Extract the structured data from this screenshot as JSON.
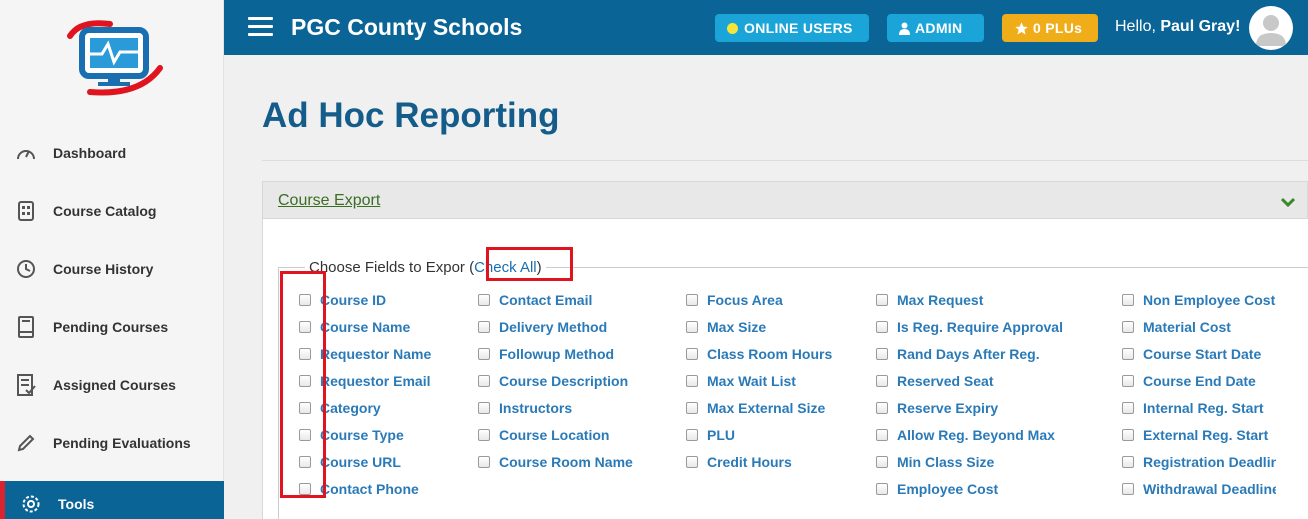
{
  "header": {
    "brand": "PGC County Schools",
    "online_users": "ONLINE USERS",
    "admin": "ADMIN",
    "plus": "0 PLUs",
    "hello": "Hello,",
    "user": "Paul Gray!"
  },
  "sidebar": {
    "items": [
      {
        "label": "Dashboard",
        "icon": "gauge-icon"
      },
      {
        "label": "Course Catalog",
        "icon": "catalog-icon"
      },
      {
        "label": "Course History",
        "icon": "history-icon"
      },
      {
        "label": "Pending Courses",
        "icon": "book-icon"
      },
      {
        "label": "Assigned Courses",
        "icon": "checklist-icon"
      },
      {
        "label": "Pending Evaluations",
        "icon": "pencil-icon"
      },
      {
        "label": "Tools",
        "icon": "gear-icon",
        "active": true
      }
    ]
  },
  "main": {
    "title": "Ad Hoc Reporting",
    "panel_title": "Course Export",
    "legend_text": "Choose Fields to Expor",
    "check_all": "Check All"
  },
  "fields": {
    "col1": [
      "Course ID",
      "Course Name",
      "Requestor Name",
      "Requestor Email",
      "Category",
      "Course Type",
      "Course URL",
      "Contact Phone"
    ],
    "col2": [
      "Contact Email",
      "Delivery Method",
      "Followup Method",
      "Course Description",
      "Instructors",
      "Course Location",
      "Course Room Name"
    ],
    "col3": [
      "Focus Area",
      "Max Size",
      "Class Room Hours",
      "Max Wait List",
      "Max External Size",
      "PLU",
      "Credit Hours"
    ],
    "col4": [
      "Max Request",
      "Is Reg. Require Approval",
      "Rand Days After Reg.",
      "Reserved Seat",
      "Reserve Expiry",
      "Allow Reg. Beyond Max",
      "Min Class Size",
      "Employee Cost"
    ],
    "col5": [
      "Non Employee Cost",
      "Material Cost",
      "Course Start Date",
      "Course End Date",
      "Internal Reg. Start",
      "External Reg. Start",
      "Registration Deadline",
      "Withdrawal Deadline"
    ]
  },
  "colors": {
    "primary": "#0a6496",
    "accent": "#1aa4d8",
    "gold": "#f0ad1a",
    "highlight": "#e0141e"
  }
}
